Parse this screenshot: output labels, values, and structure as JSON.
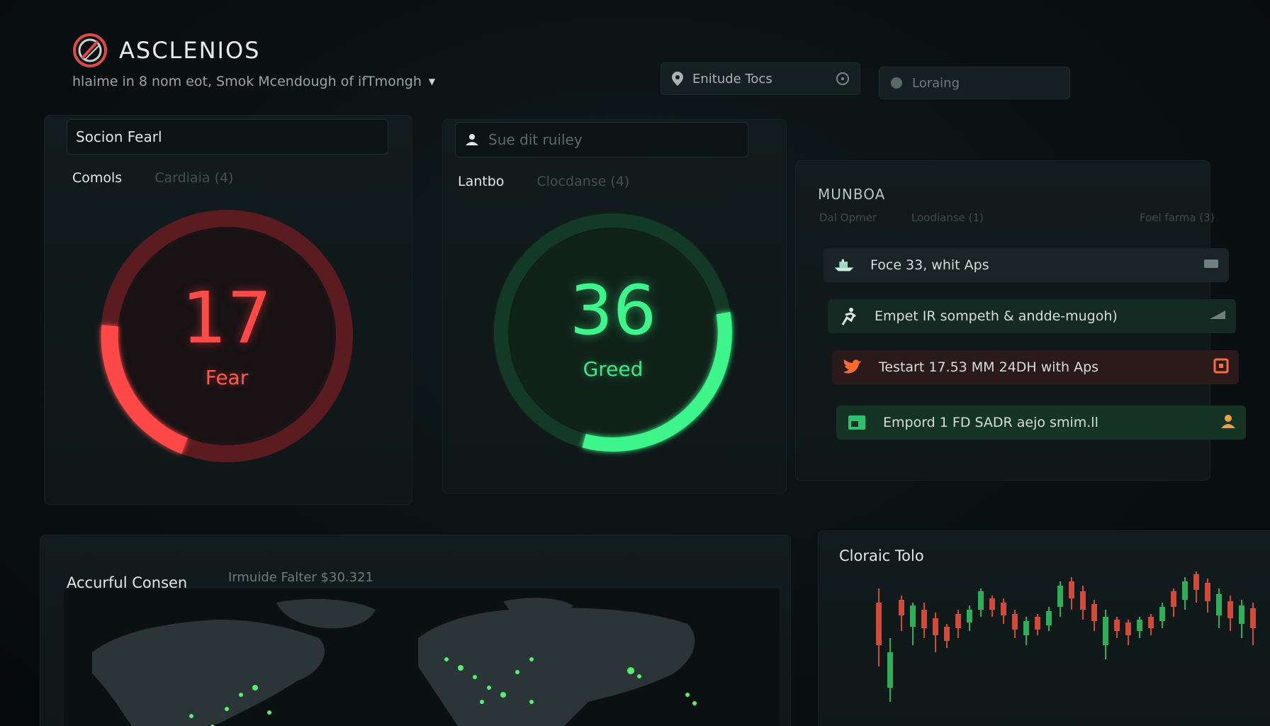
{
  "header": {
    "brand": "ASCLENIOS",
    "subtitle": "hlaime in 8 nom eot, Smok Mcendough of ifTmongh",
    "location_field": "Enitude Tocs",
    "loading_field": "Loraing"
  },
  "fear_panel": {
    "input_value": "Socion Fearl",
    "tabs": [
      "Comols",
      "Cardiaia (4)"
    ],
    "value": 17,
    "label": "Fear",
    "color": "#ff4a48"
  },
  "greed_panel": {
    "input_placeholder": "Sue dit ruiley",
    "tabs": [
      "Lantbo",
      "Clocdanse (4)"
    ],
    "value": 36,
    "label": "Greed",
    "color": "#3df58a"
  },
  "feed_panel": {
    "title": "MUNBOA",
    "subtabs": [
      "Dal Opmer",
      "Loodianse (1)",
      "Foel farma (3)"
    ],
    "items": [
      {
        "icon": "ship-icon",
        "text": "Foce 33, whit Aps",
        "trail_icon": "flag-icon"
      },
      {
        "icon": "runner-icon",
        "text": "Empet IR sompeth & andde-mugoh)",
        "trail_icon": "flag-icon"
      },
      {
        "icon": "twitter-icon",
        "text": "Testart 17.53 MM 24DH with Aps",
        "trail_icon": "calendar-icon"
      },
      {
        "icon": "terminal-icon",
        "text": "Empord 1 FD SADR aejo smim.ll",
        "trail_icon": "user-icon"
      }
    ]
  },
  "map_panel": {
    "title": "Accurful Consen",
    "meta": "Irmuide Falter $30.321"
  },
  "chart_panel": {
    "title": "Cloraic Tolo"
  }
}
